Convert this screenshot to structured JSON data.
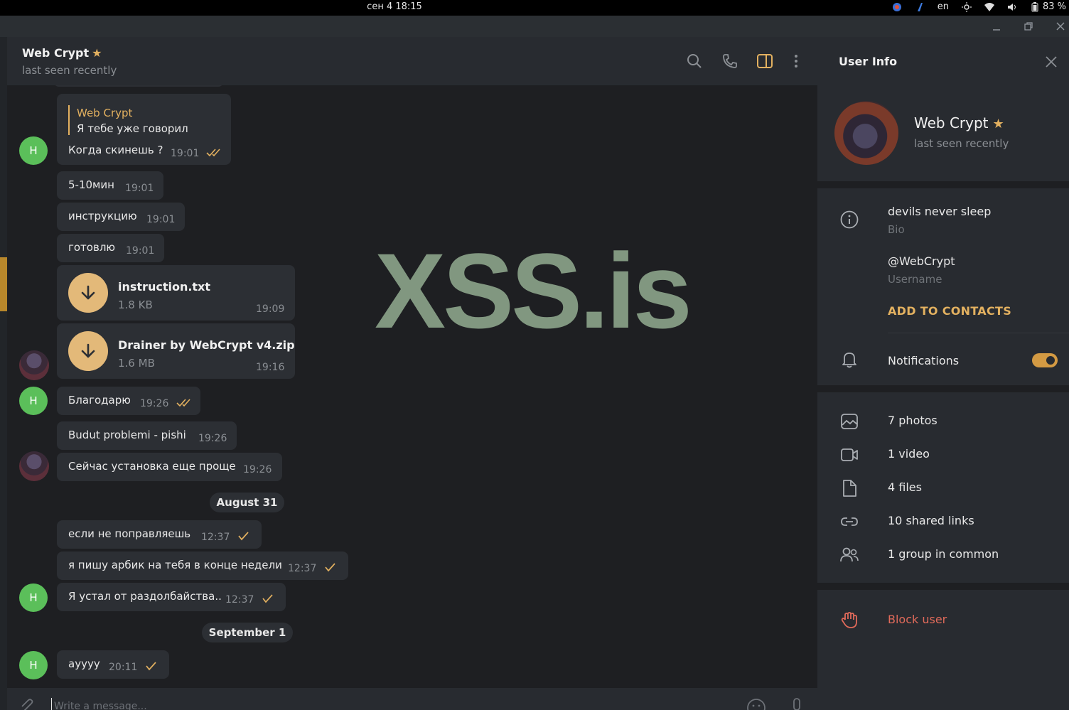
{
  "system": {
    "clock": "сен 4  18:15",
    "language": "en",
    "battery": "83 %",
    "tray_icons": [
      "browser-icon",
      "app-icon",
      "brightness-icon",
      "wifi-icon",
      "volume-icon",
      "battery-icon"
    ]
  },
  "window": {
    "controls": [
      "minimize",
      "restore",
      "close"
    ]
  },
  "chat": {
    "title": "Web Crypt",
    "status": "last seen recently",
    "watermark": "XSS.is",
    "header_icons": [
      "search-icon",
      "phone-icon",
      "sidebar-toggle-icon",
      "more-vert-icon"
    ],
    "reply": {
      "author": "Web Crypt",
      "quote": "Я тебе уже говорил"
    },
    "messages": [
      {
        "text": "Когда скинешь ?",
        "time": "19:01",
        "read": true,
        "avatar": "H"
      },
      {
        "text": "5-10мин",
        "time": "19:01"
      },
      {
        "text": "инструкцию",
        "time": "19:01"
      },
      {
        "text": "готовлю",
        "time": "19:01"
      },
      {
        "file": "instruction.txt",
        "size": "1.8 KB",
        "time": "19:09"
      },
      {
        "file": "Drainer by WebCrypt v4.zip",
        "size": "1.6 MB",
        "time": "19:16"
      },
      {
        "text": "Благодарю",
        "time": "19:26",
        "read": true,
        "avatar": "H"
      },
      {
        "text": "Budut problemi - pishi",
        "time": "19:26"
      },
      {
        "text": "Сейчас установка еще проще",
        "time": "19:26"
      },
      {
        "date": "August 31"
      },
      {
        "text": "если не поправляешь",
        "time": "12:37"
      },
      {
        "text": "я пишу арбик на тебя в конце недели",
        "time": "12:37"
      },
      {
        "text": "Я устал от раздолбайства..",
        "time": "12:37",
        "avatar": "H"
      },
      {
        "date": "September 1"
      },
      {
        "text": "ayyyy",
        "time": "20:11",
        "avatar": "H"
      }
    ],
    "composer": {
      "placeholder": "Write a message..."
    }
  },
  "info": {
    "title": "User Info",
    "name": "Web Crypt",
    "status": "last seen recently",
    "bio": "devils never sleep",
    "bio_label": "Bio",
    "username": "@WebCrypt",
    "username_label": "Username",
    "add_contacts": "ADD TO CONTACTS",
    "notifications": "Notifications",
    "notifications_on": true,
    "media": [
      {
        "label": "7 photos",
        "icon": "photo-icon"
      },
      {
        "label": "1 video",
        "icon": "video-icon"
      },
      {
        "label": "4 files",
        "icon": "file-icon"
      },
      {
        "label": "10 shared links",
        "icon": "link-icon"
      },
      {
        "label": "1 group in common",
        "icon": "group-icon"
      }
    ],
    "block": "Block user"
  },
  "colors": {
    "accent": "#e3b160",
    "avatar_green": "#5bbf5a",
    "danger": "#e06a5a",
    "bubble": "#2c2f34",
    "panel": "#282b30",
    "background": "#1e1f22"
  }
}
